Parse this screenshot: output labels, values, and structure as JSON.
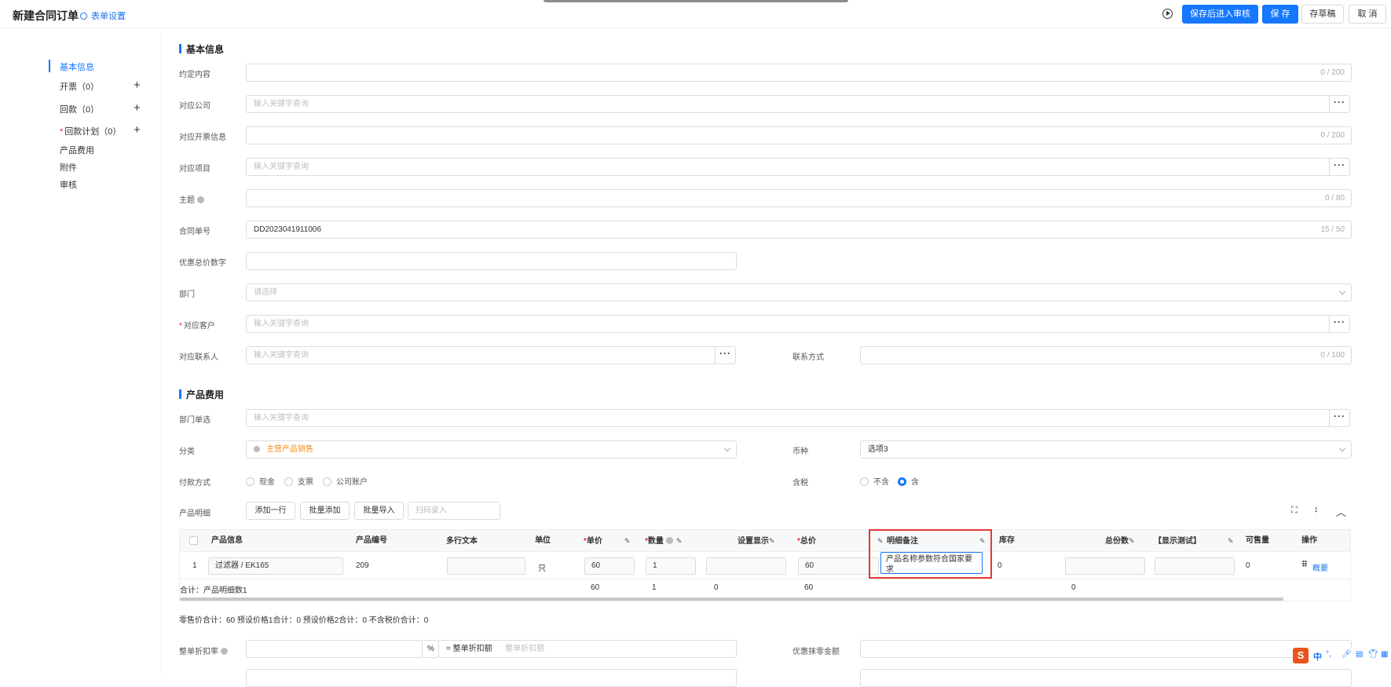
{
  "header": {
    "title": "新建合同订单",
    "form_settings": "表单设置",
    "buttons": {
      "save_submit": "保存后进入审核",
      "save": "保 存",
      "draft": "存草稿",
      "cancel": "取 消"
    }
  },
  "sidebar": {
    "items": [
      {
        "label": "基本信息"
      },
      {
        "label": "开票（0）"
      },
      {
        "label": "回款（0）"
      },
      {
        "label": "回款计划（0）"
      },
      {
        "label": "产品费用"
      },
      {
        "label": "附件"
      },
      {
        "label": "审核"
      }
    ],
    "required_mark": "*"
  },
  "basic": {
    "section_title": "基本信息",
    "fields": {
      "agreement": {
        "label": "约定内容",
        "count": "0 / 200"
      },
      "company": {
        "label": "对应公司",
        "placeholder": "输入关键字查询"
      },
      "invoice_info": {
        "label": "对应开票信息",
        "count": "0 / 200"
      },
      "project": {
        "label": "对应项目",
        "placeholder": "输入关键字查询"
      },
      "subject": {
        "label": "主题",
        "count": "0 / 80"
      },
      "contract_no": {
        "label": "合同单号",
        "value": "DD2023041911006",
        "count": "15 / 50"
      },
      "discount_total": {
        "label": "优惠总价数字"
      },
      "department": {
        "label": "部门",
        "placeholder": "请选择"
      },
      "customer": {
        "label": "对应客户",
        "placeholder": "输入关键字查询",
        "required": "*"
      },
      "contact": {
        "label": "对应联系人",
        "placeholder": "输入关键字查询"
      },
      "contact_method": {
        "label": "联系方式",
        "count": "0 / 100"
      }
    },
    "dots": "···"
  },
  "product": {
    "section_title": "产品费用",
    "dept_single": {
      "label": "部门单选",
      "placeholder": "输入关键字查询"
    },
    "category": {
      "label": "分类",
      "value": "主营产品销售"
    },
    "currency": {
      "label": "币种",
      "value": "选项3"
    },
    "payment": {
      "label": "付款方式",
      "options": [
        "现金",
        "支票",
        "公司账户"
      ]
    },
    "tax": {
      "label": "含税",
      "options": [
        "不含",
        "含"
      ],
      "selected": "含"
    },
    "detail": {
      "label": "产品明细",
      "add_row": "添加一行",
      "batch_add": "批量添加",
      "batch_import": "批量导入",
      "scan_placeholder": "扫码录入"
    },
    "table": {
      "headers": [
        "产品信息",
        "产品编号",
        "多行文本",
        "单位",
        "单价",
        "数量",
        "设置显示",
        "总价",
        "明细备注",
        "库存",
        "总份数",
        "【显示测试】",
        "可售量",
        "操作"
      ],
      "required": "*",
      "row": {
        "index": "1",
        "product": "过滤器 / EK165",
        "code": "209",
        "unit": "只",
        "price": "60",
        "qty": "1",
        "total": "60",
        "remark": "产品名称参数符合国家要求",
        "stock": "0",
        "sellable": "0",
        "action": "概要"
      },
      "footer": {
        "label": "合计：产品明细数1",
        "price": "60",
        "qty": "1",
        "setting": "0",
        "total": "60",
        "portions": "0"
      }
    },
    "summary": "零售价合计：60  预设价格1合计：0  预设价格2合计：0  不含税价合计：0",
    "discount_rate": {
      "label": "整单折扣率",
      "unit": "%",
      "eq_label": "= 整单折扣额",
      "placeholder": "整单折扣额"
    },
    "rounding": {
      "label": "优惠抹零金额"
    }
  },
  "ime": {
    "logo": "S",
    "lang": "中"
  }
}
